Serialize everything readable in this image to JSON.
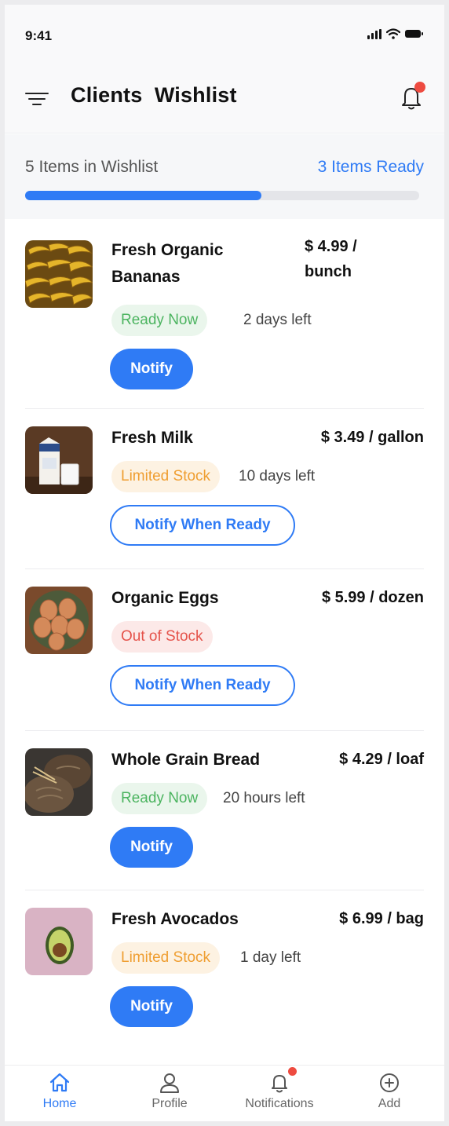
{
  "status_bar": {
    "time": "9:41"
  },
  "header": {
    "title": "Clients  Wishlist"
  },
  "progress": {
    "items_text": "5 Items in Wishlist",
    "ready_text": "3 Items Ready",
    "fraction": 0.6
  },
  "items": [
    {
      "name_line1": "Fresh Organic",
      "name_line2": "Bananas",
      "price_line1": "$ 4.99 /",
      "price_line2": "bunch",
      "status": "Ready Now",
      "time_left": "2 days left",
      "action": "Notify"
    },
    {
      "name": "Fresh Milk",
      "price": "$ 3.49 / gallon",
      "status": "Limited Stock",
      "time_left": "10 days left",
      "action": "Notify When Ready"
    },
    {
      "name": "Organic Eggs",
      "price": "$ 5.99 / dozen",
      "status": "Out of Stock",
      "action": "Notify When Ready"
    },
    {
      "name": "Whole Grain Bread",
      "price": "$ 4.29 / loaf",
      "status": "Ready Now",
      "time_left": "20 hours left",
      "action": "Notify"
    },
    {
      "name": "Fresh Avocados",
      "price": "$ 6.99 / bag",
      "status": "Limited Stock",
      "time_left": "1 day left",
      "action": "Notify"
    }
  ],
  "nav": [
    {
      "label": "Home",
      "icon": "home-icon"
    },
    {
      "label": "Profile",
      "icon": "user-icon"
    },
    {
      "label": "Notifications",
      "icon": "bell-icon"
    },
    {
      "label": "Add",
      "icon": "plus-circle-icon"
    }
  ],
  "colors": {
    "accent": "#2f7bf5",
    "ready": "#4cb460",
    "limited": "#ef9e31",
    "out": "#e5534b",
    "badge_dot": "#ee4b40"
  }
}
